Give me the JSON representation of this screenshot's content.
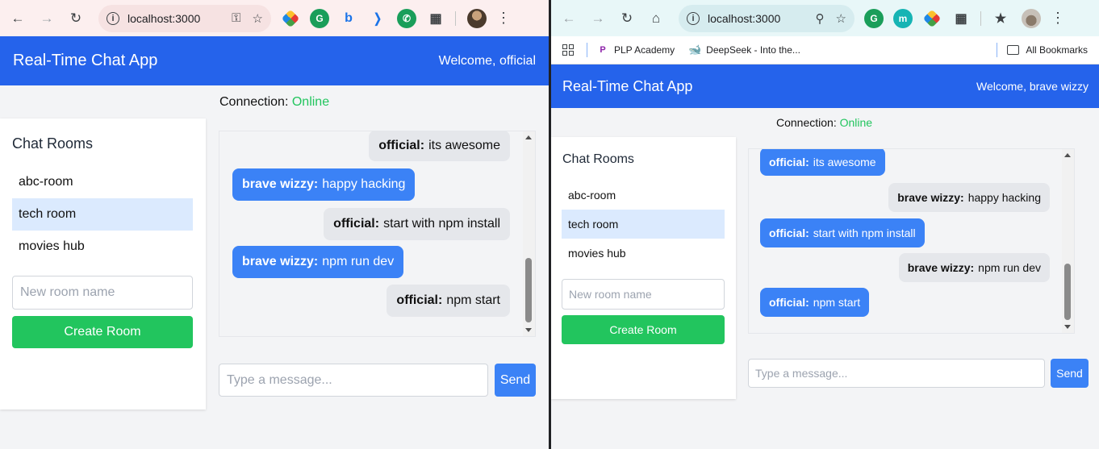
{
  "left_window": {
    "url": "localhost:3000",
    "app_title": "Real-Time Chat App",
    "welcome": "Welcome, official",
    "connection_label": "Connection:",
    "connection_status": "Online",
    "sidebar_title": "Chat Rooms",
    "rooms": [
      "abc-room",
      "tech room",
      "movies hub"
    ],
    "active_room": "tech room",
    "new_room_placeholder": "New room name",
    "create_room_label": "Create Room",
    "messages": [
      {
        "sender": "official:",
        "text": "its awesome",
        "own": false
      },
      {
        "sender": "brave wizzy:",
        "text": "happy hacking",
        "own": true
      },
      {
        "sender": "official:",
        "text": "start with npm install",
        "own": false
      },
      {
        "sender": "brave wizzy:",
        "text": "npm run dev",
        "own": true
      },
      {
        "sender": "official:",
        "text": "npm start",
        "own": false
      }
    ],
    "message_placeholder": "Type a message...",
    "send_label": "Send"
  },
  "right_window": {
    "url": "localhost:3000",
    "bookmarks": [
      "PLP Academy",
      "DeepSeek - Into the..."
    ],
    "all_bookmarks": "All Bookmarks",
    "app_title": "Real-Time Chat App",
    "welcome": "Welcome, brave wizzy",
    "connection_label": "Connection:",
    "connection_status": "Online",
    "sidebar_title": "Chat Rooms",
    "rooms": [
      "abc-room",
      "tech room",
      "movies hub"
    ],
    "active_room": "tech room",
    "new_room_placeholder": "New room name",
    "create_room_label": "Create Room",
    "messages": [
      {
        "sender": "official:",
        "text": "its awesome",
        "own": false
      },
      {
        "sender": "brave wizzy:",
        "text": "happy hacking",
        "own": true
      },
      {
        "sender": "official:",
        "text": "start with npm install",
        "own": false
      },
      {
        "sender": "brave wizzy:",
        "text": "npm run dev",
        "own": true
      },
      {
        "sender": "official:",
        "text": "npm start",
        "own": false
      }
    ],
    "message_placeholder": "Type a message...",
    "send_label": "Send"
  },
  "colors": {
    "header": "#2563eb",
    "online": "#22c55e",
    "create_button": "#22c55e",
    "own_bubble": "#3b82f6",
    "other_bubble": "#e5e7eb",
    "active_room": "#dbeafe"
  }
}
